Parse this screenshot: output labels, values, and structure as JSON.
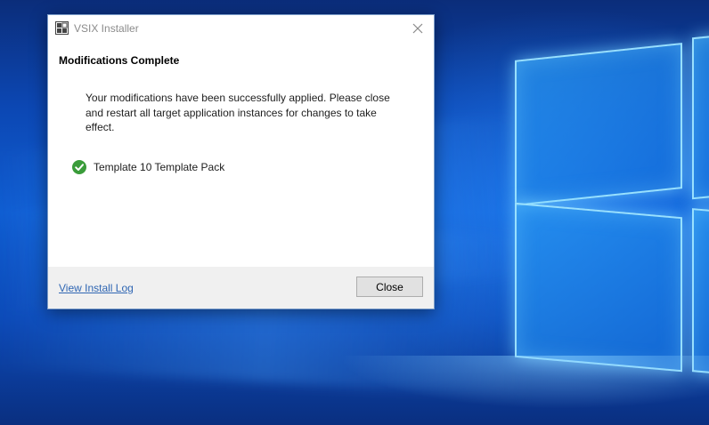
{
  "window": {
    "title": "VSIX Installer",
    "app_icon": "vsix-installer-icon",
    "close_icon": "close-icon"
  },
  "content": {
    "heading": "Modifications Complete",
    "message": "Your modifications have been successfully applied. Please close and restart all target application instances for changes to take effect.",
    "extensions": [
      {
        "name": "Template 10 Template Pack",
        "status_icon": "check-circle-icon",
        "status_color": "#3a9c3a"
      }
    ]
  },
  "footer": {
    "log_link": "View Install Log",
    "close_button": "Close"
  },
  "colors": {
    "link": "#2f66b3",
    "footer_bg": "#f0f0f0",
    "title_text": "#8b8b8b"
  }
}
